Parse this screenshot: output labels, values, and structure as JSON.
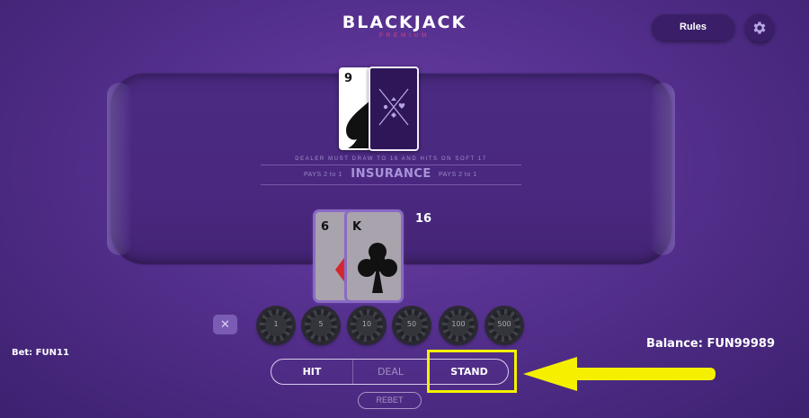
{
  "header": {
    "logo_main": "BLACKJACK",
    "logo_sub": "PREMIUM",
    "rules_label": "Rules"
  },
  "dealer": {
    "cards": [
      {
        "rank": "9",
        "suit": "spades"
      },
      {
        "rank": "",
        "face": "down"
      }
    ]
  },
  "table": {
    "rule_text": "DEALER MUST DRAW TO 16 AND HITS ON SOFT 17",
    "insurance_label": "INSURANCE",
    "pays_left": "PAYS 2 to 1",
    "pays_right": "PAYS 2 to 1"
  },
  "player": {
    "cards": [
      {
        "rank": "6",
        "suit": "diamonds"
      },
      {
        "rank": "K",
        "suit": "clubs"
      }
    ],
    "score": "16"
  },
  "chips": [
    {
      "label": "1"
    },
    {
      "label": "5"
    },
    {
      "label": "10"
    },
    {
      "label": "50"
    },
    {
      "label": "100"
    },
    {
      "label": "500"
    }
  ],
  "bet": "Bet: FUN11",
  "balance": "Balance: FUN99989",
  "actions": {
    "hit": "HIT",
    "deal": "DEAL",
    "stand": "STAND",
    "rebet": "REBET"
  },
  "colors": {
    "highlight": "#f5f000",
    "accent": "#e0457e",
    "background": "#55308e"
  }
}
